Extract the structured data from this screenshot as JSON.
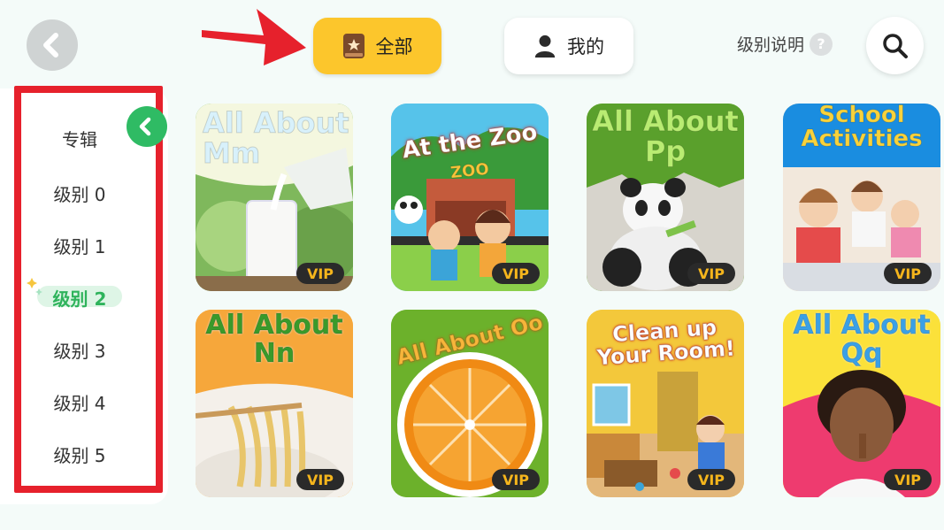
{
  "header": {
    "tab_all_label": "全部",
    "tab_mine_label": "我的",
    "level_info_label": "级别说明",
    "help_glyph": "?"
  },
  "sidebar": {
    "items": [
      {
        "label": "专辑",
        "active": false
      },
      {
        "label": "级别 0",
        "active": false
      },
      {
        "label": "级别 1",
        "active": false
      },
      {
        "label": "级别 2",
        "active": true
      },
      {
        "label": "级别 3",
        "active": false
      },
      {
        "label": "级别 4",
        "active": false
      },
      {
        "label": "级别 5",
        "active": false
      }
    ]
  },
  "cards": [
    {
      "title": "All About Mm",
      "badge": "VIP"
    },
    {
      "title": "At the Zoo",
      "sign": "ZOO",
      "badge": "VIP"
    },
    {
      "title": "All About Pp",
      "badge": "VIP"
    },
    {
      "title": "School Activities",
      "badge": "VIP"
    },
    {
      "title": "All About Nn",
      "badge": "VIP"
    },
    {
      "title": "All About Oo",
      "badge": "VIP"
    },
    {
      "title": "Clean up Your Room!",
      "badge": "VIP"
    },
    {
      "title": "All About Qq",
      "badge": "VIP"
    }
  ],
  "icons": {
    "back": "chevron-left-icon",
    "all_tab": "star-book-icon",
    "mine_tab": "person-icon",
    "help": "question-icon",
    "search": "search-icon",
    "collapse": "chevron-left-icon"
  },
  "colors": {
    "active_tab": "#fcc62c",
    "accent_green": "#2eb35b",
    "annotation_red": "#e6212c",
    "vip_text": "#f5b51c"
  }
}
